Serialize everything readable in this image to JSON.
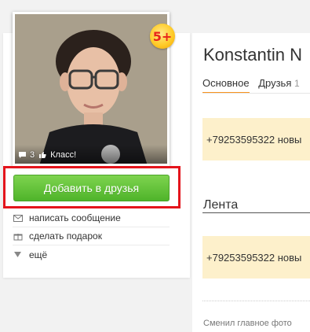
{
  "profile": {
    "age_badge": "5+",
    "photo_stats": {
      "comments": "3",
      "klass": "Класс!"
    },
    "add_friend": "Добавить в друзья",
    "actions": [
      {
        "label": "написать сообщение",
        "icon": "envelope-icon"
      },
      {
        "label": "сделать подарок",
        "icon": "gift-icon"
      },
      {
        "label": "ещё",
        "icon": "triangle-down-icon"
      }
    ]
  },
  "main": {
    "name": "Konstantin N",
    "tabs": [
      {
        "label": "Основное",
        "count": ""
      },
      {
        "label": "Друзья",
        "count": "1"
      }
    ],
    "notes": [
      "+79253595322 новы",
      "+79253595322 новы"
    ],
    "lenta_title": "Лента",
    "feed_item": "Сменил главное фото"
  },
  "colors": {
    "add_button": "#4fb42a",
    "highlight_border": "#e4141c",
    "tab_active": "#f7931e",
    "note_bg": "#fdf0cb"
  }
}
